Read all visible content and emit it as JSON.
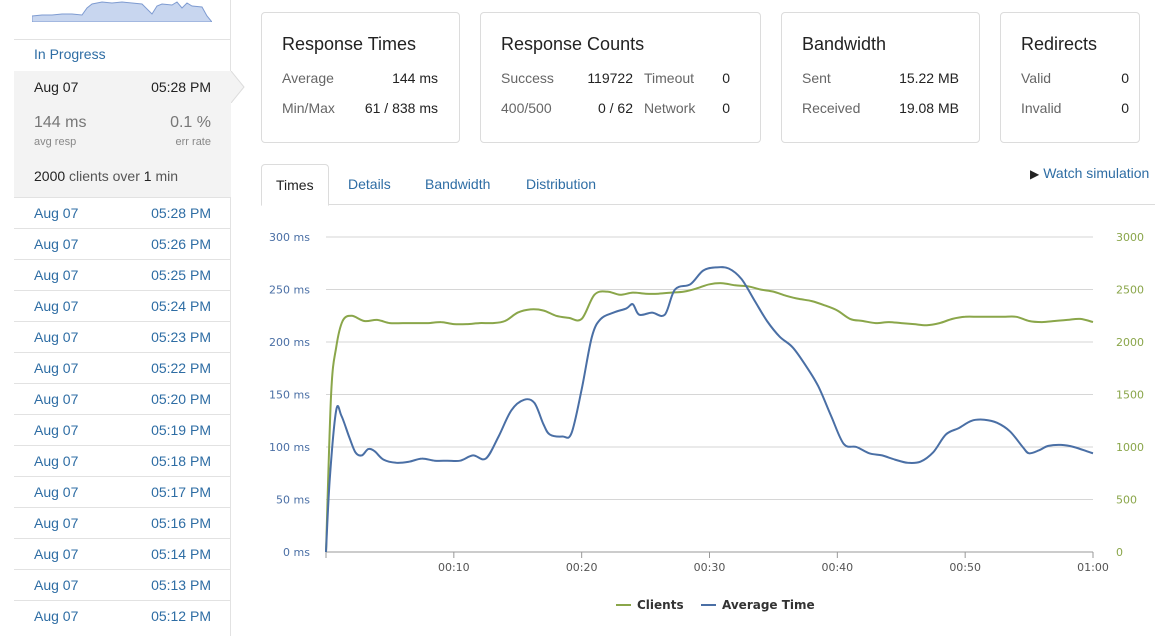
{
  "sidebar": {
    "in_progress_label": "In Progress",
    "active_run": {
      "date": "Aug 07",
      "time": "05:28 PM",
      "avg_resp": "144 ms",
      "avg_resp_label": "avg resp",
      "err_rate": "0.1 %",
      "err_rate_label": "err rate",
      "clients_count": "2000",
      "clients_mid": "clients over",
      "duration": "1",
      "duration_unit": "min"
    },
    "runs": [
      {
        "date": "Aug 07",
        "time": "05:28 PM"
      },
      {
        "date": "Aug 07",
        "time": "05:26 PM"
      },
      {
        "date": "Aug 07",
        "time": "05:25 PM"
      },
      {
        "date": "Aug 07",
        "time": "05:24 PM"
      },
      {
        "date": "Aug 07",
        "time": "05:23 PM"
      },
      {
        "date": "Aug 07",
        "time": "05:22 PM"
      },
      {
        "date": "Aug 07",
        "time": "05:20 PM"
      },
      {
        "date": "Aug 07",
        "time": "05:19 PM"
      },
      {
        "date": "Aug 07",
        "time": "05:18 PM"
      },
      {
        "date": "Aug 07",
        "time": "05:17 PM"
      },
      {
        "date": "Aug 07",
        "time": "05:16 PM"
      },
      {
        "date": "Aug 07",
        "time": "05:14 PM"
      },
      {
        "date": "Aug 07",
        "time": "05:13 PM"
      },
      {
        "date": "Aug 07",
        "time": "05:12 PM"
      }
    ]
  },
  "cards": {
    "response_times": {
      "title": "Response Times",
      "average_label": "Average",
      "average_value": "144 ms",
      "minmax_label": "Min/Max",
      "minmax_value": "61 / 838 ms"
    },
    "response_counts": {
      "title": "Response Counts",
      "success_label": "Success",
      "success_value": "119722",
      "timeout_label": "Timeout",
      "timeout_value": "0",
      "err_label": "400/500",
      "err_value": "0 / 62",
      "network_label": "Network",
      "network_value": "0"
    },
    "bandwidth": {
      "title": "Bandwidth",
      "sent_label": "Sent",
      "sent_value": "15.22 MB",
      "received_label": "Received",
      "received_value": "19.08 MB"
    },
    "redirects": {
      "title": "Redirects",
      "valid_label": "Valid",
      "valid_value": "0",
      "invalid_label": "Invalid",
      "invalid_value": "0"
    }
  },
  "tabs": [
    "Times",
    "Details",
    "Bandwidth",
    "Distribution"
  ],
  "active_tab": "Times",
  "watch_label": "Watch simulation",
  "colors": {
    "clients": "#8aa64a",
    "average_time": "#4a6fa5",
    "link": "#2e6da4",
    "sparkline_fill": "#c8d6ef"
  },
  "chart_data": {
    "type": "line",
    "x_ticks": [
      "00:10",
      "00:20",
      "00:30",
      "00:40",
      "00:50",
      "01:00"
    ],
    "x_range_seconds": [
      0,
      60
    ],
    "y_left_ticks": [
      "0 ms",
      "50 ms",
      "100 ms",
      "150 ms",
      "200 ms",
      "250 ms",
      "300 ms"
    ],
    "y_left_range": [
      0,
      300
    ],
    "y_right_ticks": [
      "0",
      "500",
      "1000",
      "1500",
      "2000",
      "2500",
      "3000"
    ],
    "y_right_range": [
      0,
      3000
    ],
    "grid": true,
    "legend_placement": "bottom",
    "series": [
      {
        "name": "Clients",
        "axis": "right",
        "points": [
          [
            0,
            0
          ],
          [
            0.4,
            1500
          ],
          [
            0.8,
            1950
          ],
          [
            1.3,
            2200
          ],
          [
            2,
            2250
          ],
          [
            3,
            2200
          ],
          [
            4,
            2210
          ],
          [
            5,
            2180
          ],
          [
            6,
            2180
          ],
          [
            7,
            2180
          ],
          [
            8,
            2180
          ],
          [
            9,
            2190
          ],
          [
            10,
            2170
          ],
          [
            11,
            2170
          ],
          [
            12,
            2180
          ],
          [
            13,
            2180
          ],
          [
            14,
            2200
          ],
          [
            15,
            2280
          ],
          [
            16,
            2310
          ],
          [
            17,
            2300
          ],
          [
            18,
            2250
          ],
          [
            19,
            2230
          ],
          [
            20,
            2220
          ],
          [
            21,
            2450
          ],
          [
            22,
            2480
          ],
          [
            23,
            2450
          ],
          [
            24,
            2470
          ],
          [
            25,
            2460
          ],
          [
            26,
            2460
          ],
          [
            27,
            2470
          ],
          [
            28,
            2480
          ],
          [
            29,
            2510
          ],
          [
            30,
            2550
          ],
          [
            31,
            2560
          ],
          [
            32,
            2540
          ],
          [
            33,
            2530
          ],
          [
            34,
            2500
          ],
          [
            35,
            2480
          ],
          [
            36,
            2440
          ],
          [
            37,
            2410
          ],
          [
            38,
            2390
          ],
          [
            39,
            2350
          ],
          [
            40,
            2300
          ],
          [
            41,
            2220
          ],
          [
            42,
            2200
          ],
          [
            43,
            2180
          ],
          [
            44,
            2190
          ],
          [
            45,
            2180
          ],
          [
            46,
            2170
          ],
          [
            47,
            2160
          ],
          [
            48,
            2180
          ],
          [
            49,
            2220
          ],
          [
            50,
            2240
          ],
          [
            51,
            2240
          ],
          [
            52,
            2240
          ],
          [
            53,
            2240
          ],
          [
            54,
            2240
          ],
          [
            55,
            2200
          ],
          [
            56,
            2190
          ],
          [
            57,
            2200
          ],
          [
            58,
            2210
          ],
          [
            59,
            2220
          ],
          [
            60,
            2190
          ]
        ]
      },
      {
        "name": "Average Time",
        "axis": "left",
        "points": [
          [
            0,
            0
          ],
          [
            0.3,
            70
          ],
          [
            0.8,
            135
          ],
          [
            1.2,
            130
          ],
          [
            1.8,
            110
          ],
          [
            2.3,
            95
          ],
          [
            2.8,
            92
          ],
          [
            3.3,
            98
          ],
          [
            3.8,
            96
          ],
          [
            4.5,
            88
          ],
          [
            5.5,
            85
          ],
          [
            6.5,
            86
          ],
          [
            7.5,
            89
          ],
          [
            8.5,
            87
          ],
          [
            9.5,
            87
          ],
          [
            10.5,
            87
          ],
          [
            11.5,
            92
          ],
          [
            12.5,
            89
          ],
          [
            13.5,
            110
          ],
          [
            14.5,
            135
          ],
          [
            15.5,
            145
          ],
          [
            16.3,
            142
          ],
          [
            17,
            122
          ],
          [
            17.5,
            112
          ],
          [
            18.5,
            110
          ],
          [
            19.2,
            113
          ],
          [
            20,
            155
          ],
          [
            20.8,
            205
          ],
          [
            21.5,
            222
          ],
          [
            22.5,
            228
          ],
          [
            23.5,
            232
          ],
          [
            24,
            236
          ],
          [
            24.5,
            226
          ],
          [
            25.5,
            228
          ],
          [
            26.5,
            226
          ],
          [
            27.3,
            250
          ],
          [
            28.5,
            255
          ],
          [
            29.5,
            268
          ],
          [
            30.5,
            271
          ],
          [
            31.5,
            270
          ],
          [
            32.5,
            260
          ],
          [
            33.5,
            240
          ],
          [
            34.5,
            220
          ],
          [
            35.5,
            205
          ],
          [
            36.5,
            195
          ],
          [
            37.5,
            178
          ],
          [
            38.5,
            158
          ],
          [
            39.5,
            130
          ],
          [
            40.5,
            103
          ],
          [
            41.5,
            100
          ],
          [
            42.5,
            94
          ],
          [
            43.5,
            92
          ],
          [
            44.5,
            88
          ],
          [
            45.5,
            85
          ],
          [
            46.5,
            86
          ],
          [
            47.5,
            95
          ],
          [
            48.5,
            112
          ],
          [
            49.5,
            118
          ],
          [
            50.5,
            125
          ],
          [
            51.5,
            126
          ],
          [
            52.5,
            123
          ],
          [
            53.5,
            115
          ],
          [
            54.5,
            100
          ],
          [
            55,
            94
          ],
          [
            55.8,
            97
          ],
          [
            56.5,
            101
          ],
          [
            57.5,
            102
          ],
          [
            58.5,
            100
          ],
          [
            59.5,
            96
          ],
          [
            60,
            94
          ]
        ]
      }
    ]
  }
}
